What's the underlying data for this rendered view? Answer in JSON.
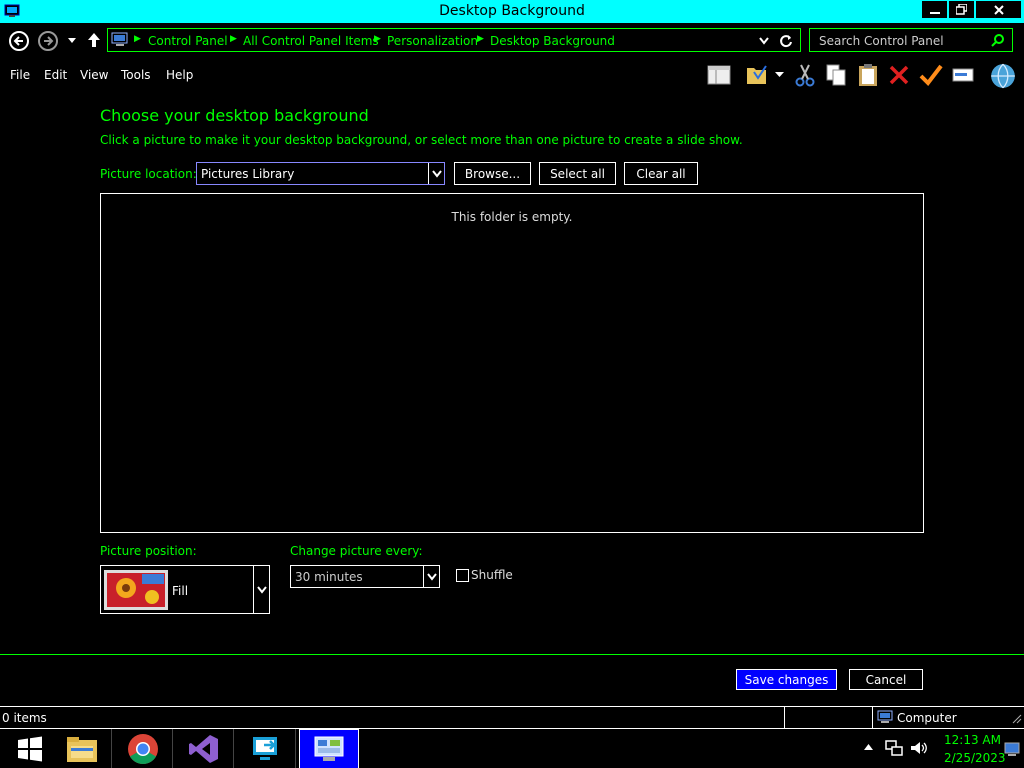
{
  "window": {
    "title": "Desktop Background",
    "controls": {
      "minimize": "minimize-icon",
      "restore": "restore-icon",
      "close": "close-icon"
    }
  },
  "address_bar": {
    "crumbs": [
      "Control Panel",
      "All Control Panel Items",
      "Personalization",
      "Desktop Background"
    ],
    "search_placeholder": "Search Control Panel"
  },
  "menu": [
    "File",
    "Edit",
    "View",
    "Tools",
    "Help"
  ],
  "toolbar_icons": [
    "layout-icon",
    "folder-options-icon",
    "cut-icon",
    "copy-icon",
    "paste-icon",
    "delete-icon",
    "properties-icon",
    "rename-icon",
    "globe-icon"
  ],
  "main": {
    "heading": "Choose your desktop background",
    "subheading": "Click a picture to make it your desktop background, or select more than one picture to create a slide show.",
    "picture_location_label": "Picture location:",
    "picture_location_value": "Pictures Library",
    "browse_label": "Browse...",
    "select_all_label": "Select all",
    "clear_all_label": "Clear all",
    "empty_message": "This folder is empty.",
    "picture_position_label": "Picture position:",
    "picture_position_value": "Fill",
    "change_picture_label": "Change picture every:",
    "change_picture_value": "30 minutes",
    "shuffle_label": "Shuffle",
    "shuffle_checked": false,
    "save_label": "Save changes",
    "cancel_label": "Cancel"
  },
  "statusbar": {
    "items_count": "0 items",
    "location": "Computer"
  },
  "taskbar": {
    "apps": [
      "windows-start-icon",
      "file-explorer-icon",
      "chrome-icon",
      "visual-studio-icon",
      "remote-app-icon",
      "control-panel-icon"
    ],
    "time": "12:13 AM",
    "date": "2/25/2023"
  },
  "colors": {
    "accent": "#00ff00",
    "titlebar": "#00ffff",
    "primary_button": "#0000ff",
    "background": "#000000"
  }
}
